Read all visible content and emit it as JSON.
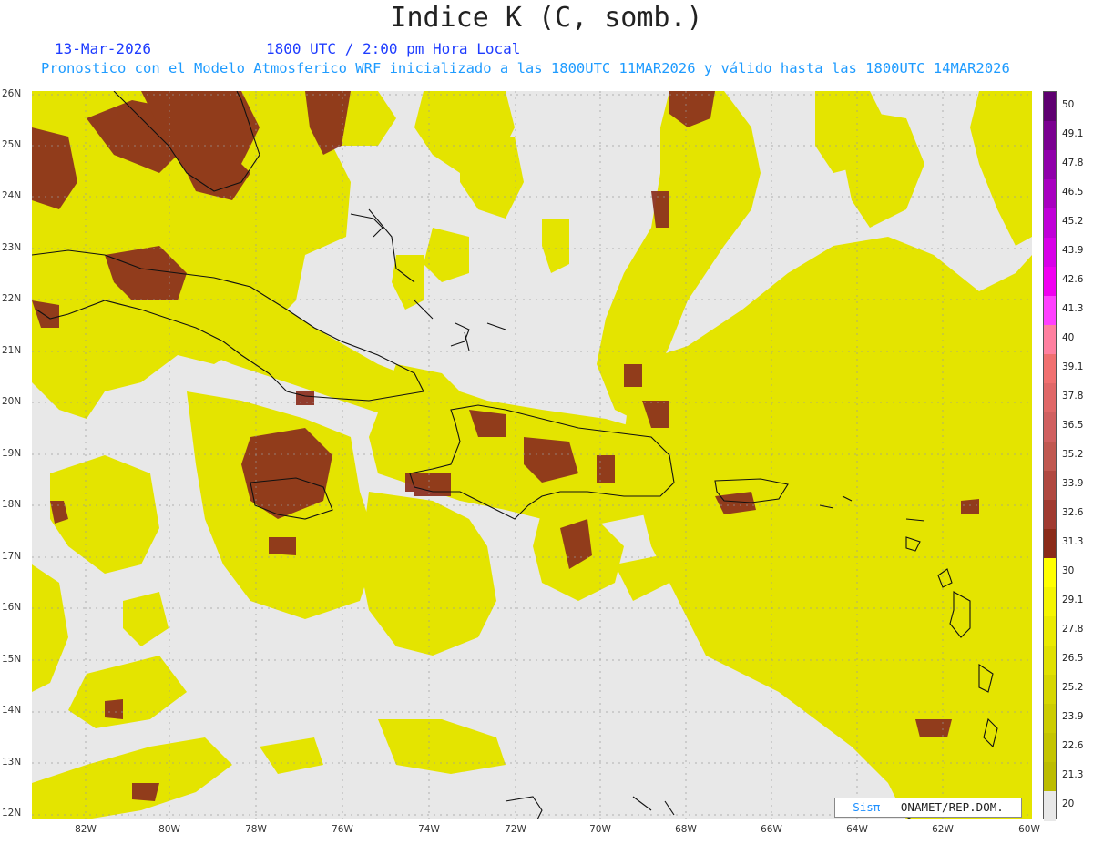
{
  "header": {
    "title": "Indice K (C, somb.)",
    "date": "13-Mar-2026",
    "time_info": "1800 UTC / 2:00 pm Hora Local",
    "forecast_info": "Pronostico con el Modelo Atmosferico WRF inicializado a las 1800UTC_11MAR2026 y válido hasta las  1800UTC_14MAR2026"
  },
  "axes": {
    "lat_labels": [
      "26N",
      "25N",
      "24N",
      "23N",
      "22N",
      "21N",
      "20N",
      "19N",
      "18N",
      "17N",
      "16N",
      "15N",
      "14N",
      "13N",
      "12N"
    ],
    "lon_labels": [
      "82W",
      "80W",
      "78W",
      "76W",
      "74W",
      "72W",
      "70W",
      "68W",
      "66W",
      "64W",
      "62W",
      "60W"
    ]
  },
  "colorbar": {
    "labels": [
      "50",
      "49.1",
      "47.8",
      "46.5",
      "45.2",
      "43.9",
      "42.6",
      "41.3",
      "40",
      "39.1",
      "37.8",
      "36.5",
      "35.2",
      "33.9",
      "32.6",
      "31.3",
      "30",
      "29.1",
      "27.8",
      "26.5",
      "25.2",
      "23.9",
      "22.6",
      "21.3",
      "20"
    ],
    "colors": [
      "#5e0070",
      "#7a0090",
      "#9000aa",
      "#a800c0",
      "#c000d8",
      "#d800e8",
      "#f000f0",
      "#ff40ff",
      "#ff80a0",
      "#f07070",
      "#e06868",
      "#d06060",
      "#c05850",
      "#b04840",
      "#a03a30",
      "#8a2a18",
      "#ffff00",
      "#f4f400",
      "#eaea00",
      "#e0e000",
      "#d6d600",
      "#cccc00",
      "#c4c400",
      "#bcbc00",
      "#e8e8e8"
    ],
    "domain_map": {
      "lat_range": [
        12,
        26
      ],
      "lon_range": [
        -83,
        -60
      ]
    }
  },
  "credit": {
    "sis": "Sisπ",
    "text": "– ONAMET/REP.DOM."
  },
  "icons": [
    "coastline-map"
  ]
}
